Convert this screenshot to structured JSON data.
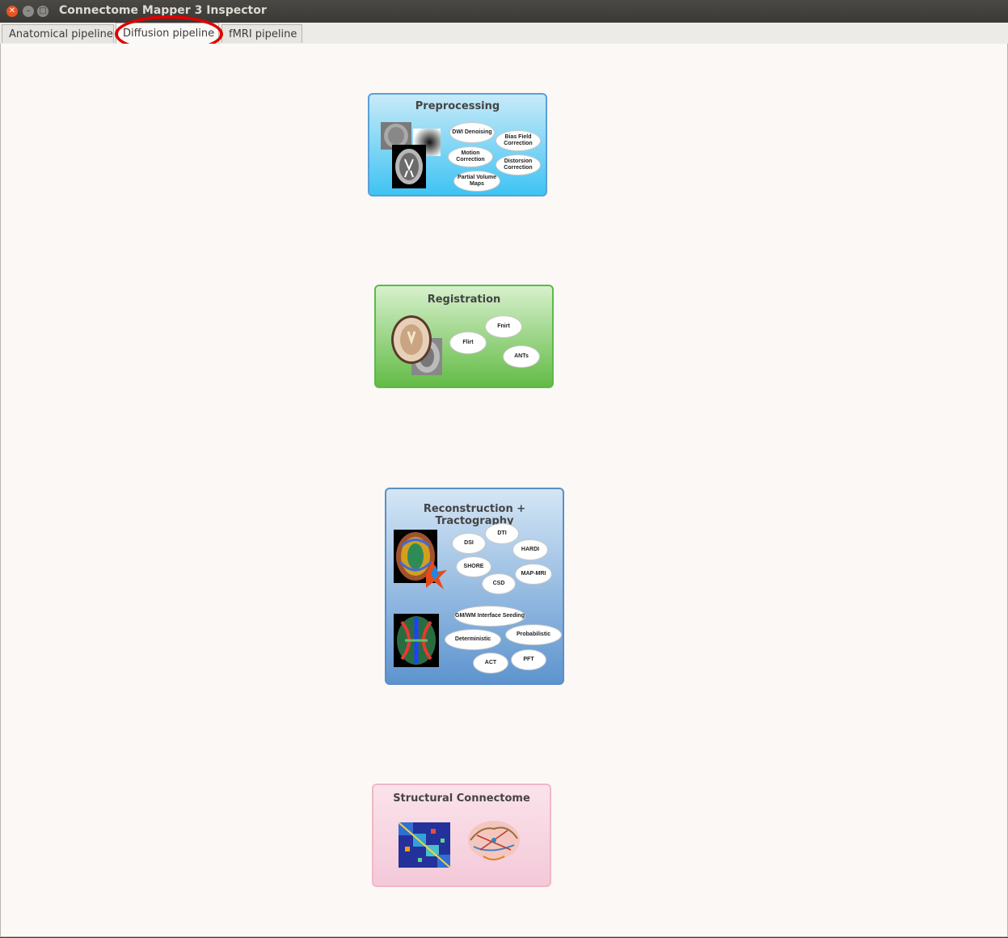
{
  "window": {
    "title": "Connectome Mapper 3 Inspector"
  },
  "tabs": [
    {
      "label": "Anatomical pipeline"
    },
    {
      "label": "Diffusion pipeline",
      "selected": true
    },
    {
      "label": "fMRI pipeline"
    }
  ],
  "stages": {
    "preprocessing": {
      "title": "Preprocessing",
      "steps": [
        "DWI Denoising",
        "Bias Field Correction",
        "Motion Correction",
        "Distorsion Correction",
        "Partial Volume Maps"
      ]
    },
    "registration": {
      "title": "Registration",
      "steps": [
        "Fnirt",
        "Flirt",
        "ANTs"
      ]
    },
    "reconstruction": {
      "title": "Reconstruction + Tractography",
      "recon_steps": [
        "DTI",
        "DSI",
        "HARDI",
        "SHORE",
        "MAP-MRI",
        "CSD"
      ],
      "tract_steps": [
        "GM/WM Interface Seeding",
        "Deterministic",
        "Probabilistic",
        "ACT",
        "PFT"
      ]
    },
    "connectome": {
      "title": "Structural Connectome"
    }
  },
  "colors": {
    "preprocessing": "#3fc3f3",
    "registration": "#63bb46",
    "reconstruction": "#5e94cf",
    "connectome": "#f3c9d9",
    "annotation": "#e00000"
  }
}
